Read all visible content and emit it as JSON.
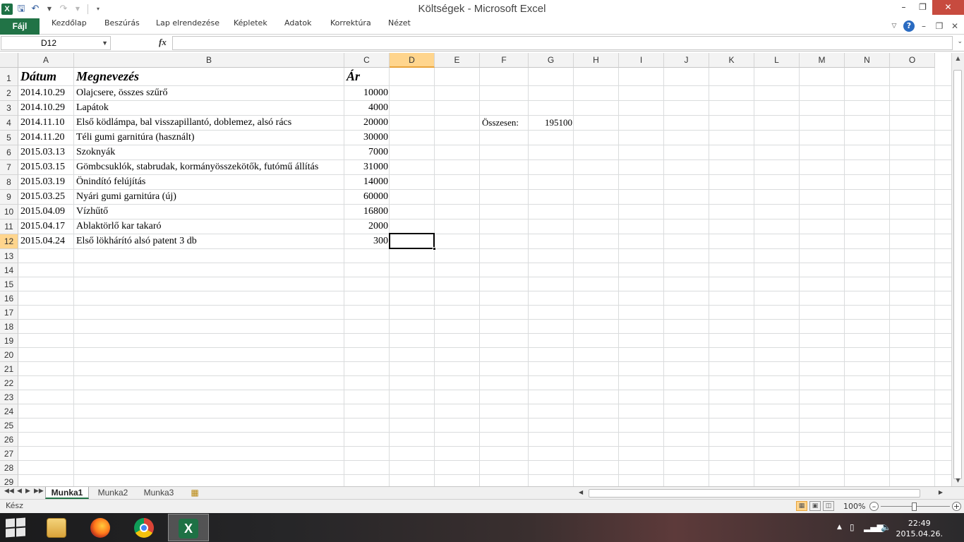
{
  "window": {
    "title": "Költségek - Microsoft Excel",
    "minimize": "–",
    "restore": "❐",
    "close": "✕"
  },
  "qat": {
    "excel_icon": "X",
    "save_icon": "save-icon",
    "undo_icon": "undo-icon",
    "redo_icon": "redo-icon",
    "customize_icon": "chevron-down-icon"
  },
  "ribbon": {
    "file": "Fájl",
    "tabs": [
      "Kezdőlap",
      "Beszúrás",
      "Lap elrendezése",
      "Képletek",
      "Adatok",
      "Korrektúra",
      "Nézet"
    ]
  },
  "formula_bar": {
    "name_box": "D12",
    "fx": "fx",
    "formula": ""
  },
  "columns": [
    "A",
    "B",
    "C",
    "D",
    "E",
    "F",
    "G",
    "H",
    "I",
    "J",
    "K",
    "L",
    "M",
    "N",
    "O"
  ],
  "rows": [
    "1",
    "2",
    "3",
    "4",
    "5",
    "6",
    "7",
    "8",
    "9",
    "10",
    "11",
    "12",
    "13",
    "14",
    "15",
    "16",
    "17",
    "18",
    "19",
    "20",
    "21",
    "22",
    "23",
    "24",
    "25",
    "26",
    "27",
    "28",
    "29"
  ],
  "cells": {
    "A1": "Dátum",
    "B1": "Megnevezés",
    "C1": "Ár",
    "A2": "2014.10.29",
    "B2": "Olajcsere, összes szűrő",
    "C2": "10000",
    "A3": "2014.10.29",
    "B3": "Lapátok",
    "C3": "4000",
    "A4": "2014.11.10",
    "B4": "Első ködlámpa, bal visszapillantó, doblemez, alsó rács",
    "C4": "20000",
    "A5": "2014.11.20",
    "B5": "Téli gumi garnitúra (használt)",
    "C5": "30000",
    "A6": "2015.03.13",
    "B6": "Szoknyák",
    "C6": "7000",
    "A7": "2015.03.15",
    "B7": "Gömbcsuklók, stabrudak, kormányösszekötők, futómű állítás",
    "C7": "31000",
    "A8": "2015.03.19",
    "B8": "Önindító felújítás",
    "C8": "14000",
    "A9": "2015.03.25",
    "B9": "Nyári gumi garnitúra (új)",
    "C9": "60000",
    "A10": "2015.04.09",
    "B10": "Vízhűtő",
    "C10": "16800",
    "A11": "2015.04.17",
    "B11": "Ablaktörlő kar takaró",
    "C11": "2000",
    "A12": "2015.04.24",
    "B12": "Első lökhárító alsó patent 3 db",
    "C12": "300",
    "F4": "Összesen:",
    "G4": "195100"
  },
  "active_cell": "D12",
  "sheet_tabs": [
    "Munka1",
    "Munka2",
    "Munka3"
  ],
  "active_sheet": "Munka1",
  "status": {
    "ready": "Kész",
    "zoom": "100%"
  },
  "taskbar": {
    "time": "22:49",
    "date": "2015.04.26."
  },
  "colors": {
    "excel_green": "#217346",
    "selected_header": "#ffd58d",
    "close_button": "#c74b3f"
  }
}
